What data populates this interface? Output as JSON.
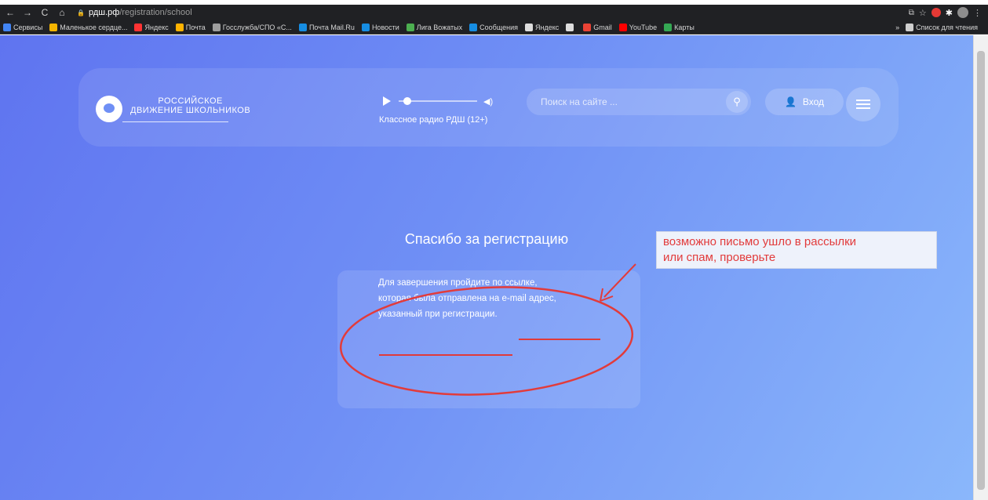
{
  "browser": {
    "url_host": "рдш.рф",
    "url_path": "/registration/school",
    "nav": [
      "←",
      "→",
      "C",
      "⌂"
    ]
  },
  "bookmarks": [
    {
      "label": "Сервисы",
      "color": "#4285f4"
    },
    {
      "label": "Маленькое сердце...",
      "color": "#f4b400"
    },
    {
      "label": "Яндекс",
      "color": "#ff3333"
    },
    {
      "label": "Почта",
      "color": "#ffb300"
    },
    {
      "label": "Госслужба/СПО «С...",
      "color": "#9e9e9e"
    },
    {
      "label": "Почта Mail.Ru",
      "color": "#168de2"
    },
    {
      "label": "Новости",
      "color": "#168de2"
    },
    {
      "label": "Лига Вожатых",
      "color": "#4caf50"
    },
    {
      "label": "Сообщения",
      "color": "#168de2"
    },
    {
      "label": "Яндекс",
      "color": "#dddddd"
    },
    {
      "label": "",
      "color": "#dddddd"
    },
    {
      "label": "Gmail",
      "color": "#ea4335"
    },
    {
      "label": "YouTube",
      "color": "#ff0000"
    },
    {
      "label": "Карты",
      "color": "#34a853"
    }
  ],
  "bookmarks_more": "»",
  "reading_list": "Список для чтения",
  "site": {
    "logo_line1": "РОССИЙСКОЕ",
    "logo_line2": "ДВИЖЕНИЕ ШКОЛЬНИКОВ",
    "radio_label": "Классное радио РДШ (12+)",
    "volume": "◀)",
    "search_placeholder": "Поиск на сайте ...",
    "search_icon": "⚲",
    "login_icon": "👤",
    "login_label": "Вход"
  },
  "main": {
    "title": "Спасибо за регистрацию",
    "text_line1": "Для завершения пройдите по ссылке,",
    "text_line2": "которая была отправлена на e-mail адрес,",
    "text_line3": "указанный при регистрации."
  },
  "annotation": {
    "note_line1": "возможно письмо ушло в рассылки",
    "note_line2": "или спам, проверьте",
    "color": "#e23b3b"
  }
}
